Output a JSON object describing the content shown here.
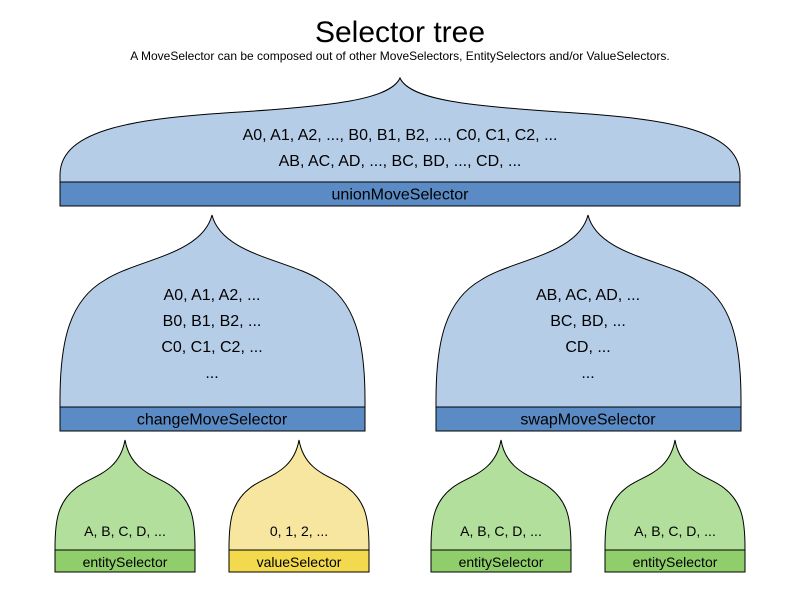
{
  "title": "Selector tree",
  "subtitle": "A MoveSelector can be composed out of other MoveSelectors, EntitySelectors and/or ValueSelectors.",
  "root": {
    "label": "unionMoveSelector",
    "lines": [
      "A0, A1, A2, ..., B0, B1, B2, ..., C0, C1, C2, ...",
      "AB, AC, AD, ..., BC, BD, ..., CD, ..."
    ]
  },
  "mid": {
    "left": {
      "label": "changeMoveSelector",
      "lines": [
        "A0, A1, A2, ...",
        "B0, B1, B2, ...",
        "C0, C1, C2, ...",
        "..."
      ]
    },
    "right": {
      "label": "swapMoveSelector",
      "lines": [
        "AB, AC, AD, ...",
        "BC, BD, ...",
        "CD, ...",
        "..."
      ]
    }
  },
  "leaves": [
    {
      "label": "entitySelector",
      "content": "A, B, C, D, ...",
      "kind": "entity"
    },
    {
      "label": "valueSelector",
      "content": "0, 1, 2, ...",
      "kind": "value"
    },
    {
      "label": "entitySelector",
      "content": "A, B, C, D, ...",
      "kind": "entity"
    },
    {
      "label": "entitySelector",
      "content": "A, B, C, D, ...",
      "kind": "entity"
    }
  ]
}
